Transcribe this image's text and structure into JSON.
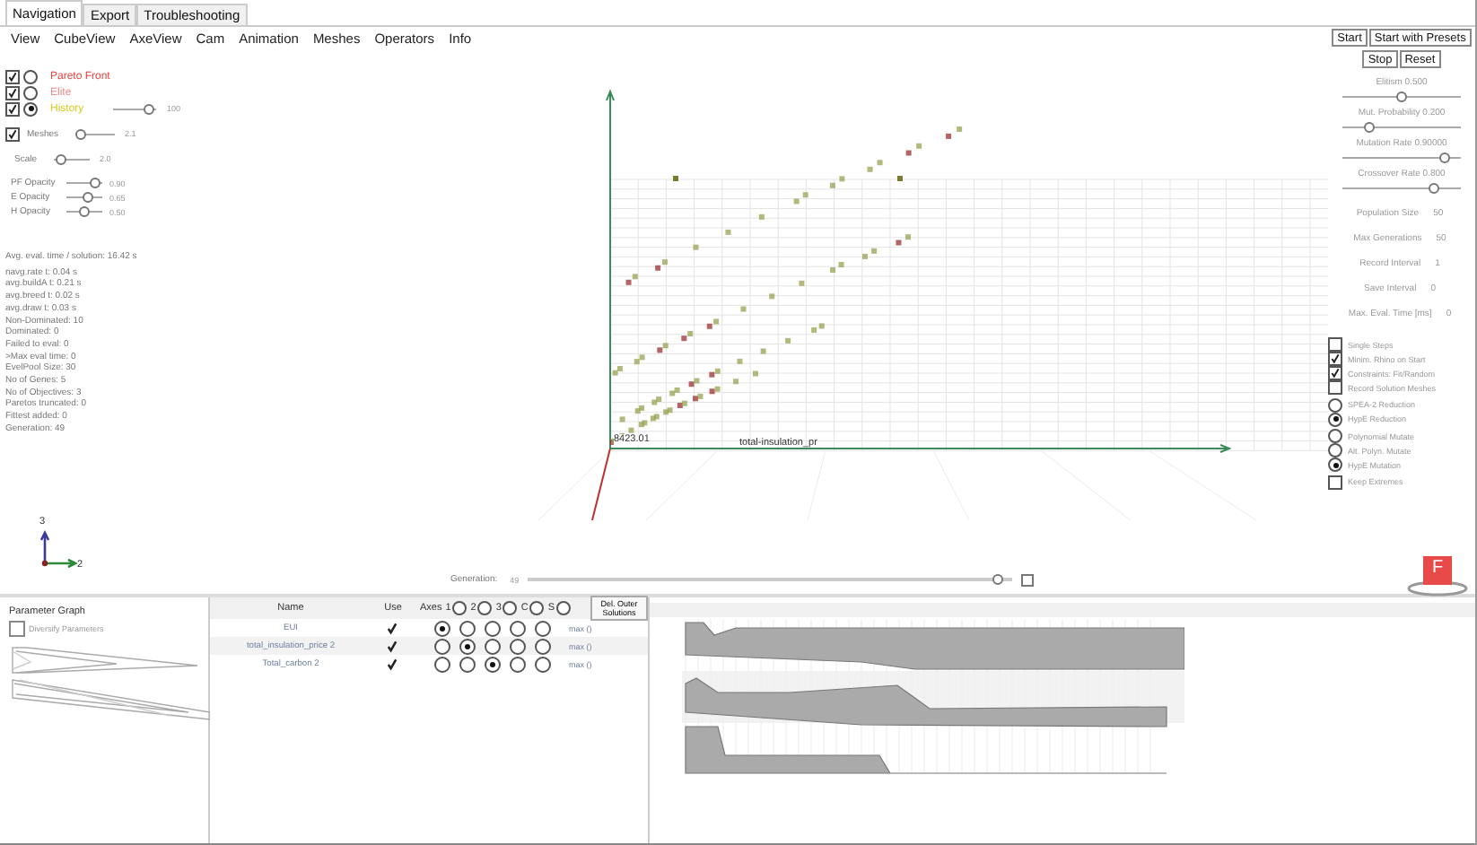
{
  "tabs": [
    {
      "label": "Navigation",
      "selected": true
    },
    {
      "label": "Export",
      "selected": false
    },
    {
      "label": "Troubleshooting",
      "selected": false
    }
  ],
  "menu": [
    "View",
    "CubeView",
    "AxeView",
    "Cam",
    "Animation",
    "Meshes",
    "Operators",
    "Info"
  ],
  "layers": [
    {
      "label": "Pareto Front",
      "color": "#e8413c",
      "visible": true,
      "selected": false
    },
    {
      "label": "Elite",
      "color": "#f08a8a",
      "visible": true,
      "selected": false
    },
    {
      "label": "History",
      "color": "#d8cc20",
      "visible": true,
      "selected": true,
      "slider": {
        "level": 0.95,
        "reading": "100"
      }
    }
  ],
  "meshes": {
    "label": "Meshes",
    "checked": true,
    "level": 0.05,
    "reading": "2.1"
  },
  "scale": {
    "label": "Scale",
    "level": 0.12,
    "reading": "2.0"
  },
  "opacities": [
    {
      "label": "PF Opacity",
      "level": 0.95,
      "reading": "0.90"
    },
    {
      "label": "E Opacity",
      "level": 0.65,
      "reading": "0.65"
    },
    {
      "label": "H Opacity",
      "level": 0.5,
      "reading": "0.50"
    }
  ],
  "avg_eval": "Avg. eval. time / solution: 16.42 s",
  "stats": [
    "navg.rate t: 0.04 s",
    "avg.buildA t: 0.21 s",
    "avg.breed t: 0.02 s",
    "avg.draw t: 0.03 s",
    "Non-Dominated: 10",
    "Dominated: 0",
    "Failed to eval: 0",
    ">Max eval time: 0",
    "EvelPool Size: 30",
    "No of Genes: 5",
    "No of Objectives: 3",
    "Paretos truncated: 0",
    "Fittest added: 0",
    "Generation: 49"
  ],
  "plot": {
    "value_label": "8423.01",
    "axis_label": "total-insulation_pr"
  },
  "gizmo": {
    "vertical": "3",
    "horizontal": "2"
  },
  "generation": {
    "label": "Generation:",
    "reading": "49",
    "level": 0.98
  },
  "run_buttons": [
    [
      "Start",
      "Start with Presets"
    ],
    [
      "Stop",
      "Reset"
    ]
  ],
  "rates": [
    {
      "label": "Elitism",
      "reading": "0.500",
      "level": 0.5
    },
    {
      "label": "Mut. Probability",
      "reading": "0.200",
      "level": 0.2
    },
    {
      "label": "Mutation Rate",
      "reading": "0.90000",
      "level": 0.9
    },
    {
      "label": "Crossover Rate",
      "reading": "0.800",
      "level": 0.8
    }
  ],
  "settings": [
    {
      "label": "Population Size",
      "value": "50"
    },
    {
      "label": "Max Generations",
      "value": "50"
    },
    {
      "label": "Record Interval",
      "value": "1"
    },
    {
      "label": "Save Interval",
      "value": "0"
    },
    {
      "label": "Max. Eval. Time [ms]",
      "value": "0"
    }
  ],
  "option_groups": [
    [
      {
        "kind": "checkbox",
        "label": "Single Steps",
        "checked": false
      },
      {
        "kind": "checkbox",
        "label": "Minim. Rhino on Start",
        "checked": true
      },
      {
        "kind": "checkbox",
        "label": "Constraints: Fit/Random",
        "checked": true
      },
      {
        "kind": "checkbox",
        "label": "Record Solution Meshes",
        "checked": false
      }
    ],
    [
      {
        "kind": "radio",
        "label": "SPEA-2 Reduction",
        "selected": false
      },
      {
        "kind": "radio",
        "label": "HypE Reduction",
        "selected": true
      }
    ],
    [
      {
        "kind": "radio",
        "label": "Polynomial Mutate",
        "selected": false
      },
      {
        "kind": "radio",
        "label": "Alt. Polyn. Mutate",
        "selected": false
      },
      {
        "kind": "radio",
        "label": "HypE Mutation",
        "selected": true
      }
    ],
    [
      {
        "kind": "checkbox",
        "label": "Keep Extremes",
        "checked": false
      }
    ]
  ],
  "logo": "F",
  "parameter_graph": {
    "title": "Parameter Graph",
    "diversify": {
      "label": "Diversify Parameters",
      "checked": false
    }
  },
  "objectives": {
    "name_header": "Name",
    "use_header": "Use",
    "axes_header": "Axes",
    "axis_headers": [
      {
        "label": "1",
        "selected": false
      },
      {
        "label": "2",
        "selected": false
      },
      {
        "label": "3",
        "selected": false
      },
      {
        "label": "C",
        "selected": false
      },
      {
        "label": "S",
        "selected": false
      }
    ],
    "button": "Del. Outer Solutions",
    "rows": [
      {
        "name": "EUI",
        "use": true,
        "axes": [
          true,
          false,
          false,
          false,
          false
        ],
        "direction": "max ()"
      },
      {
        "name": "total_insulation_price 2",
        "use": true,
        "axes": [
          false,
          true,
          false,
          false,
          false
        ],
        "direction": "max ()"
      },
      {
        "name": "Total_carbon 2",
        "use": true,
        "axes": [
          false,
          false,
          true,
          false,
          false
        ],
        "direction": "max ()"
      }
    ]
  }
}
